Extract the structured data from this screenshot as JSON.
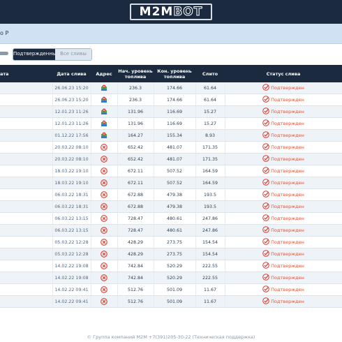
{
  "header": {
    "logo_m2m": "M2M",
    "logo_bot": "BOT"
  },
  "filter": {
    "label": "о Р"
  },
  "toggle": {
    "active": "Подтвержденные",
    "inactive": "Все сливы"
  },
  "table": {
    "headers": {
      "c0": "ата",
      "date": "Дата слива",
      "address": "Адрес",
      "start": "Нач. уровень топлива",
      "end": "Кон. уровень топлива",
      "drain": "Слито",
      "status": "Статус слива"
    },
    "rows": [
      {
        "date": "26.06.23 15:20",
        "addr": "map",
        "start": "236.3",
        "end": "174.66",
        "drain": "61.64",
        "status": "Подтвержден"
      },
      {
        "date": "26.06.23 15:20",
        "addr": "map",
        "start": "236.3",
        "end": "174.66",
        "drain": "61.64",
        "status": "Подтвержден"
      },
      {
        "date": "12.01.23 11:26",
        "addr": "map",
        "start": "131.96",
        "end": "116.69",
        "drain": "15.27",
        "status": "Подтвержден"
      },
      {
        "date": "12.01.23 11:26",
        "addr": "map",
        "start": "131.96",
        "end": "116.69",
        "drain": "15.27",
        "status": "Подтвержден"
      },
      {
        "date": "01.12.22 17:56",
        "addr": "map",
        "start": "164.27",
        "end": "155.34",
        "drain": "8.93",
        "status": "Подтвержден"
      },
      {
        "date": "20.03.22 08:10",
        "addr": "none",
        "start": "652.42",
        "end": "481.07",
        "drain": "171.35",
        "status": "Подтвержден"
      },
      {
        "date": "20.03.22 08:10",
        "addr": "none",
        "start": "652.42",
        "end": "481.07",
        "drain": "171.35",
        "status": "Подтвержден"
      },
      {
        "date": "18.03.22 19:10",
        "addr": "none",
        "start": "672.11",
        "end": "507.52",
        "drain": "164.59",
        "status": "Подтвержден"
      },
      {
        "date": "18.03.22 19:10",
        "addr": "none",
        "start": "672.11",
        "end": "507.52",
        "drain": "164.59",
        "status": "Подтвержден"
      },
      {
        "date": "06.03.22 18:31",
        "addr": "none",
        "start": "672.88",
        "end": "479.38",
        "drain": "193.5",
        "status": "Подтвержден"
      },
      {
        "date": "06.03.22 18:31",
        "addr": "none",
        "start": "672.88",
        "end": "479.38",
        "drain": "193.5",
        "status": "Подтвержден"
      },
      {
        "date": "06.03.22 13:15",
        "addr": "none",
        "start": "728.47",
        "end": "480.61",
        "drain": "247.86",
        "status": "Подтвержден"
      },
      {
        "date": "06.03.22 13:15",
        "addr": "none",
        "start": "728.47",
        "end": "480.61",
        "drain": "247.86",
        "status": "Подтвержден"
      },
      {
        "date": "05.03.22 12:28",
        "addr": "none",
        "start": "428.29",
        "end": "273.75",
        "drain": "154.54",
        "status": "Подтвержден"
      },
      {
        "date": "05.03.22 12:28",
        "addr": "none",
        "start": "428.29",
        "end": "273.75",
        "drain": "154.54",
        "status": "Подтвержден"
      },
      {
        "date": "14.02.22 19:08",
        "addr": "none",
        "start": "742.84",
        "end": "520.29",
        "drain": "222.55",
        "status": "Подтвержден"
      },
      {
        "date": "14.02.22 19:08",
        "addr": "none",
        "start": "742.84",
        "end": "520.29",
        "drain": "222.55",
        "status": "Подтвержден"
      },
      {
        "date": "14.02.22 09:41",
        "addr": "none",
        "start": "512.76",
        "end": "501.09",
        "drain": "11.67",
        "status": "Подтвержден"
      },
      {
        "date": "14.02.22 09:41",
        "addr": "none",
        "start": "512.76",
        "end": "501.09",
        "drain": "11.67",
        "status": "Подтвержден"
      }
    ]
  },
  "footer": {
    "text": "© Группа компаний М2М +7(391)205-30-22 (Техническая поддержка)"
  },
  "colors": {
    "header_bg": "#1b2a3f",
    "status": "#e0563c",
    "filter_bg": "#cfe1f2"
  },
  "icons": {
    "map": "map-marker-icon",
    "none": "no-address-icon",
    "status": "check-circle-icon"
  }
}
